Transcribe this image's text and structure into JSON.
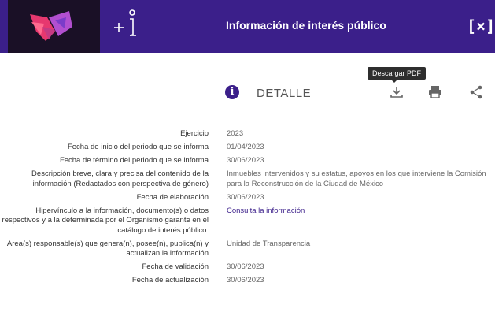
{
  "header": {
    "title": "Información de interés público",
    "close_label": "[×]"
  },
  "toolbar": {
    "section_title": "DETALLE",
    "download_tooltip": "Descargar PDF",
    "icons": [
      "info-icon",
      "download-icon",
      "print-icon",
      "share-icon"
    ]
  },
  "details": [
    {
      "label": "Ejercicio",
      "value": "2023"
    },
    {
      "label": "Fecha de inicio del periodo que se informa",
      "value": "01/04/2023"
    },
    {
      "label": "Fecha de término del periodo que se informa",
      "value": "30/06/2023"
    },
    {
      "label": "Descripción breve, clara y precisa del contenido de la información (Redactados con perspectiva de género)",
      "value": "Inmuebles intervenidos y su estatus, apoyos en los que interviene la Comisión para la Reconstrucción de la Ciudad de México"
    },
    {
      "label": "Fecha de elaboración",
      "value": "30/06/2023"
    },
    {
      "label": "Hipervínculo a la información, documento(s) o datos respectivos y a la determinada por el Organismo garante en el catálogo de interés público.",
      "value": "Consulta la información",
      "link": true
    },
    {
      "label": "Área(s) responsable(s) que genera(n), posee(n), publica(n) y actualizan la información",
      "value": "Unidad de Transparencia"
    },
    {
      "label": "Fecha de validación",
      "value": "30/06/2023"
    },
    {
      "label": "Fecha de actualización",
      "value": "30/06/2023"
    }
  ],
  "colors": {
    "header_bg": "#3b1f8a",
    "logo_bg": "#1a1026",
    "accent": "#3b1f8a",
    "tooltip_bg": "#2e2e2e"
  }
}
